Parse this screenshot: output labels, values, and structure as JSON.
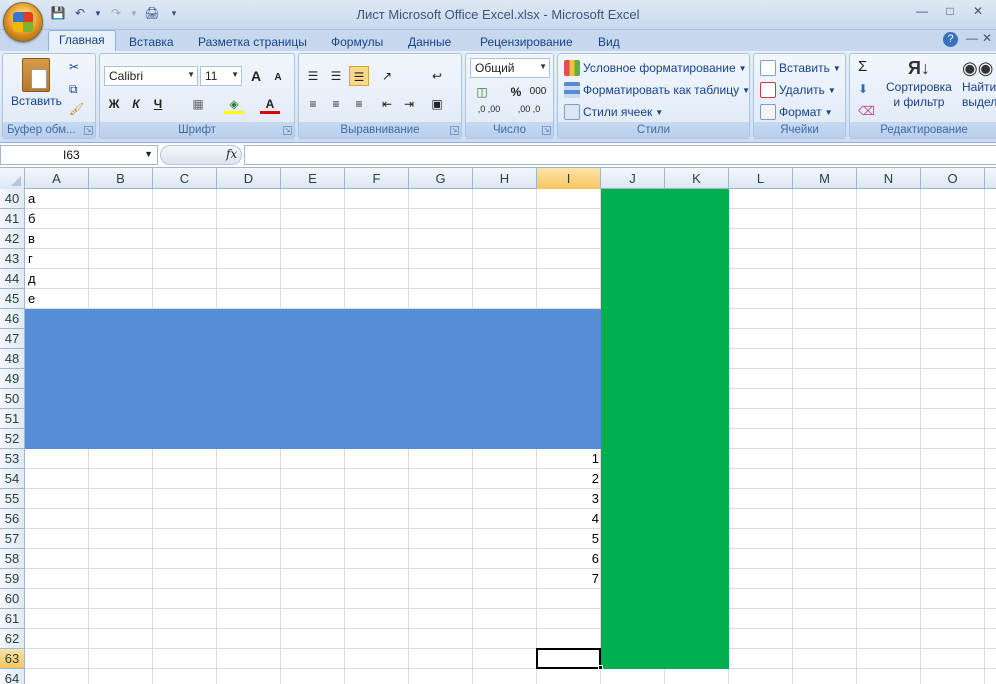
{
  "window": {
    "title": "Лист Microsoft Office Excel.xlsx - Microsoft Excel"
  },
  "tabs": [
    "Главная",
    "Вставка",
    "Разметка страницы",
    "Формулы",
    "Данные",
    "Рецензирование",
    "Вид"
  ],
  "ribbon": {
    "clipboard": {
      "label": "Буфер обм...",
      "paste": "Вставить"
    },
    "font": {
      "label": "Шрифт",
      "name": "Calibri",
      "size": "11",
      "bold": "Ж",
      "italic": "К",
      "underline": "Ч",
      "grow": "A",
      "shrink": "A",
      "color_letter": "A"
    },
    "alignment": {
      "label": "Выравнивание"
    },
    "number": {
      "label": "Число",
      "format": "Общий",
      "percent": "%",
      "thousands": "000",
      "inc_dec": ",0 ,00",
      "dec_dec": ",00 ,0"
    },
    "styles": {
      "label": "Стили",
      "conditional": "Условное форматирование",
      "as_table": "Форматировать как таблицу",
      "cell_styles": "Стили ячеек"
    },
    "cells": {
      "label": "Ячейки",
      "insert": "Вставить",
      "delete": "Удалить",
      "format": "Формат"
    },
    "editing": {
      "label": "Редактирование",
      "sort_line1": "Сортировка",
      "sort_line2": "и фильтр",
      "find": "Найти",
      "find_line2": "выдели"
    }
  },
  "formula_bar": {
    "name_box": "I63",
    "fx": "fx",
    "value": ""
  },
  "columns": [
    "A",
    "B",
    "C",
    "D",
    "E",
    "F",
    "G",
    "H",
    "I",
    "J",
    "K",
    "L",
    "M",
    "N",
    "O"
  ],
  "selected_column": "I",
  "rows": [
    "40",
    "41",
    "42",
    "43",
    "44",
    "45",
    "46",
    "47",
    "48",
    "49",
    "50",
    "51",
    "52",
    "53",
    "54",
    "55",
    "56",
    "57",
    "58",
    "59",
    "60",
    "61",
    "62",
    "63",
    "64"
  ],
  "selected_row": "63",
  "cells_A": [
    "а",
    "б",
    "в",
    "г",
    "д",
    "е"
  ],
  "cells_I": [
    "1",
    "2",
    "3",
    "4",
    "5",
    "6",
    "7"
  ],
  "colors": {
    "blue_fill": "#558ed5",
    "green_fill": "#00b050",
    "selection": "#f6c55e"
  }
}
